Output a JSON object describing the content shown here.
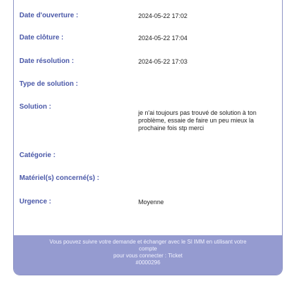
{
  "fields": [
    {
      "label": "Date d'ouverture :",
      "value": "2024-05-22 17:02"
    },
    {
      "label": "Date clôture :",
      "value": "2024-05-22 17:04"
    },
    {
      "label": "Date résolution :",
      "value": "2024-05-22 17:03"
    },
    {
      "label": "Type de solution :",
      "value": ""
    },
    {
      "label": "Solution :",
      "value": "je n'ai toujours pas trouvé de solution à ton problème, essaie de faire un peu mieux la prochaine fois stp merci"
    },
    {
      "label": "Catégorie :",
      "value": ""
    },
    {
      "label": "Matériel(s) concerné(s) :",
      "value": ""
    },
    {
      "label": "Urgence :",
      "value": "Moyenne"
    }
  ],
  "footer": {
    "line1": "Vous pouvez suivre votre demande et échanger avec le SI IMM en utilisant votre",
    "line2": "compte",
    "line3": "pour vous connecter : Ticket",
    "line4": "#0000296"
  }
}
